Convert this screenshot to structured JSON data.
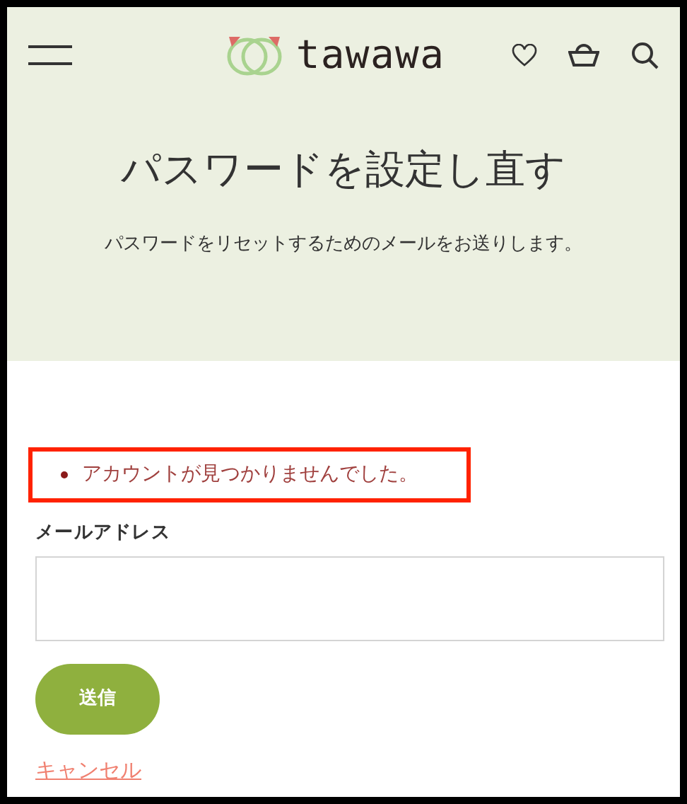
{
  "header": {
    "logo_text": "tawawa"
  },
  "hero": {
    "title": "パスワードを設定し直す",
    "subtitle": "パスワードをリセットするためのメールをお送りします。"
  },
  "errors": [
    "アカウントが見つかりませんでした。"
  ],
  "form": {
    "email_label": "メールアドレス",
    "submit": "送信",
    "cancel": "キャンセル"
  }
}
